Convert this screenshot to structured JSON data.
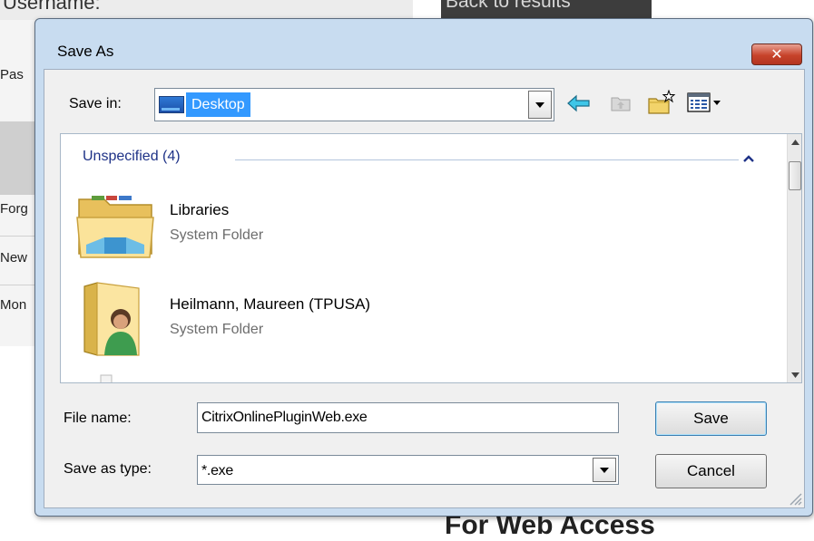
{
  "background": {
    "top_left_text": "Username:",
    "top_right_text": "Back to results",
    "left_items": [
      "Pas",
      "Forg",
      "New",
      "Mon"
    ],
    "bottom_text": "For Web Access"
  },
  "dialog": {
    "title": "Save As",
    "close_glyph": "✕",
    "save_in": {
      "label": "Save in:",
      "value": "Desktop"
    },
    "file_list": {
      "group_header": "Unspecified (4)",
      "items": [
        {
          "name": "Libraries",
          "type": "System Folder",
          "icon": "libraries-folder-icon"
        },
        {
          "name": "Heilmann, Maureen (TPUSA)",
          "type": "System Folder",
          "icon": "user-folder-icon"
        }
      ]
    },
    "file_name": {
      "label": "File name:",
      "value": "CitrixOnlinePluginWeb.exe"
    },
    "save_as_type": {
      "label": "Save as type:",
      "value": "*.exe"
    },
    "buttons": {
      "save": "Save",
      "cancel": "Cancel"
    }
  },
  "colors": {
    "selection": "#3399ff",
    "group_header": "#1e3287",
    "close_button": "#c7432b",
    "frame": "#c8dcf0"
  }
}
